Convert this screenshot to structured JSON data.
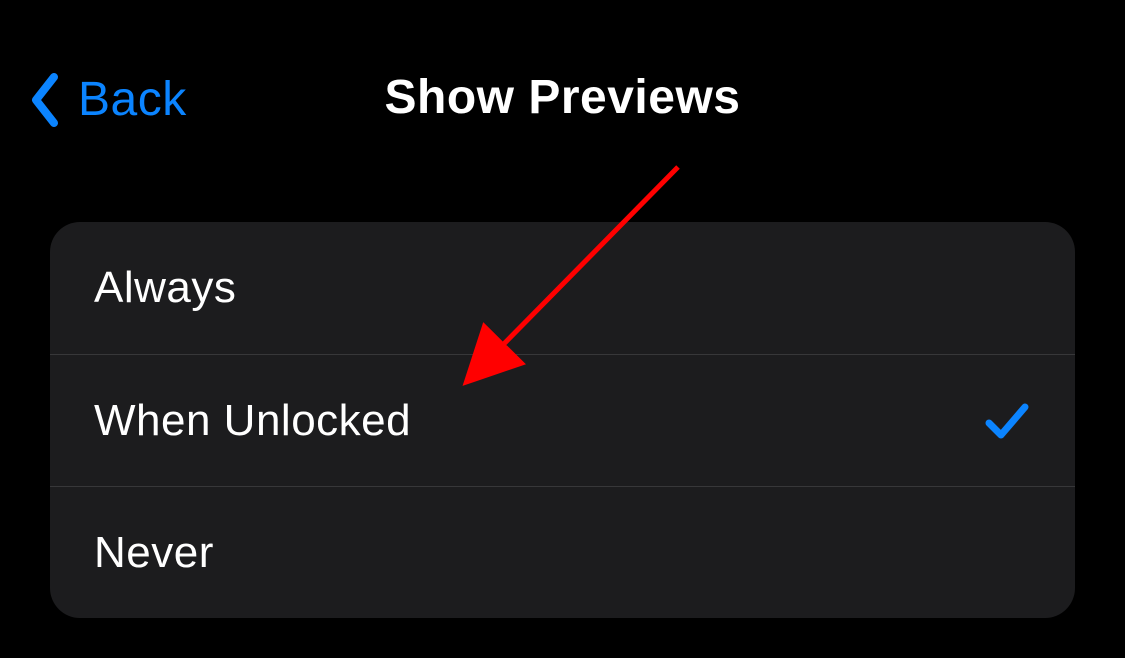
{
  "nav": {
    "back_label": "Back",
    "title": "Show Previews"
  },
  "options": [
    {
      "label": "Always",
      "selected": false
    },
    {
      "label": "When Unlocked",
      "selected": true
    },
    {
      "label": "Never",
      "selected": false
    }
  ],
  "colors": {
    "accent": "#0b84ff",
    "panel": "#1c1c1e",
    "annotation_arrow": "#ff0000"
  }
}
